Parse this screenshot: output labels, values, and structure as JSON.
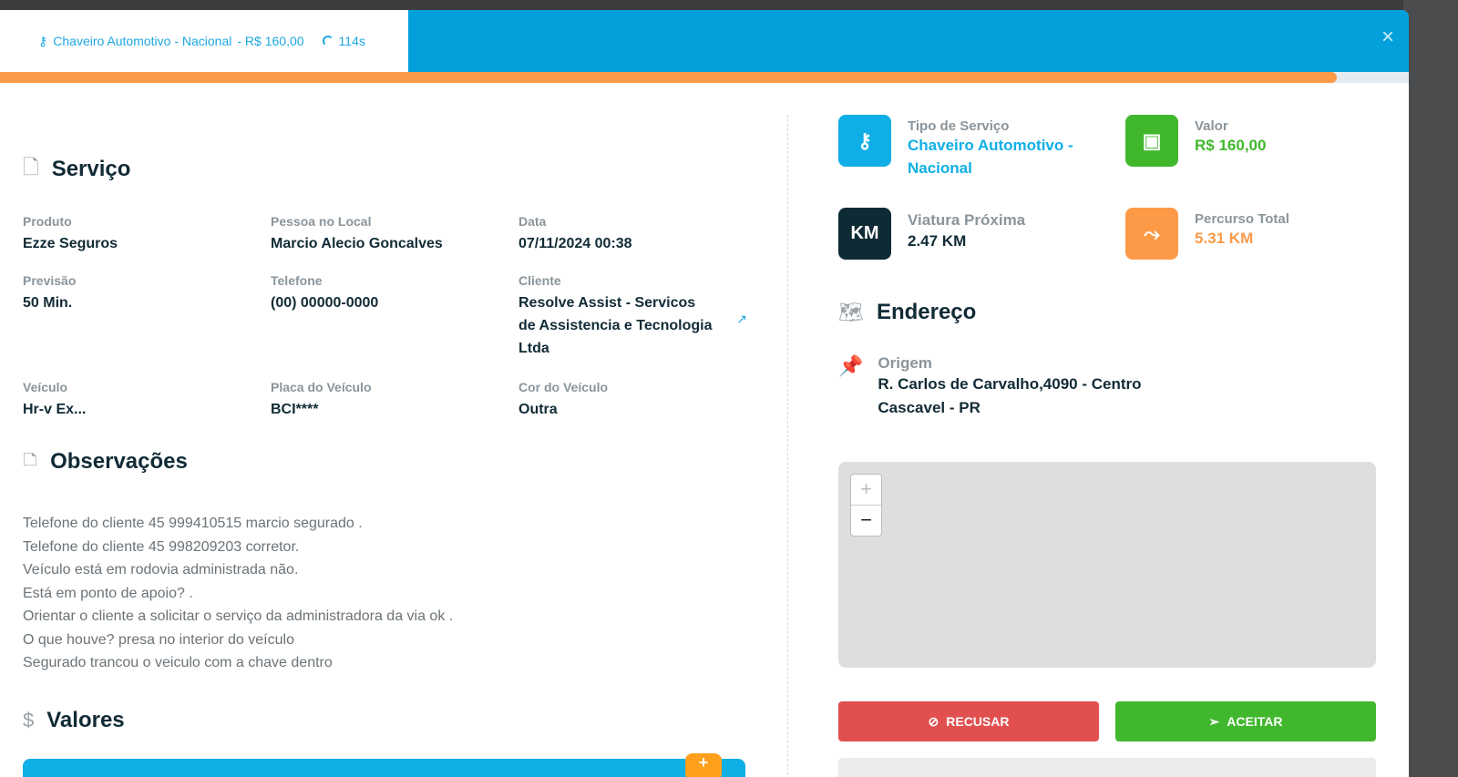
{
  "header": {
    "service": "Chaveiro Automotivo - Nacional",
    "price": "- R$ 160,00",
    "timer": "114s",
    "close": "×"
  },
  "progress": {
    "fraction": 0.949
  },
  "servico": {
    "title": "Serviço",
    "fields": [
      {
        "label": "Produto",
        "value": "Ezze Seguros"
      },
      {
        "label": "Pessoa no Local",
        "value": "Marcio Alecio Goncalves"
      },
      {
        "label": "Data",
        "value": "07/11/2024 00:38"
      },
      {
        "label": "Previsão",
        "value": "50 Min."
      },
      {
        "label": "Telefone",
        "value": "(00) 00000-0000"
      },
      {
        "label": "Cliente",
        "value": "Resolve Assist - Servicos de Assistencia e Tecnologia Ltda"
      },
      {
        "label": "Veículo",
        "value": "Hr-v Ex..."
      },
      {
        "label": "Placa do Veículo",
        "value": "BCI****"
      },
      {
        "label": "Cor do Veículo",
        "value": "Outra"
      }
    ]
  },
  "observacoes": {
    "title": "Observações",
    "lines": [
      "Telefone do cliente 45 999410515 marcio segurado .",
      "Telefone do cliente 45 998209203 corretor.",
      "Veículo está em rodovia administrada não.",
      "Está em ponto de apoio? .",
      "Orientar o cliente a solicitar o serviço da administradora da via ok .",
      "O que houve? presa no interior do veículo",
      "Segurado trancou o veiculo com a chave dentro"
    ]
  },
  "valores": {
    "title": "Valores",
    "add": "+"
  },
  "cards": {
    "tipo": {
      "label": "Tipo de Serviço",
      "value": "Chaveiro Automotivo - Nacional"
    },
    "valor": {
      "label": "Valor",
      "value": "R$ 160,00"
    },
    "viatura": {
      "label": "Viatura Próxima",
      "value": "2.47 KM",
      "icon": "KM"
    },
    "percurso": {
      "label": "Percurso Total",
      "value": "5.31 KM"
    }
  },
  "endereco": {
    "title": "Endereço",
    "origem_label": "Origem",
    "line1": "R. Carlos de Carvalho,4090 - Centro",
    "line2": "Cascavel - PR"
  },
  "map": {
    "zoom_in": "+",
    "zoom_out": "−"
  },
  "actions": {
    "recusar": "RECUSAR",
    "aceitar": "ACEITAR"
  },
  "colors": {
    "blue": "#03a0dc",
    "orange": "#fd9a48",
    "green": "#41b72d",
    "red": "#e24f4f",
    "dark": "#0e2a35"
  }
}
